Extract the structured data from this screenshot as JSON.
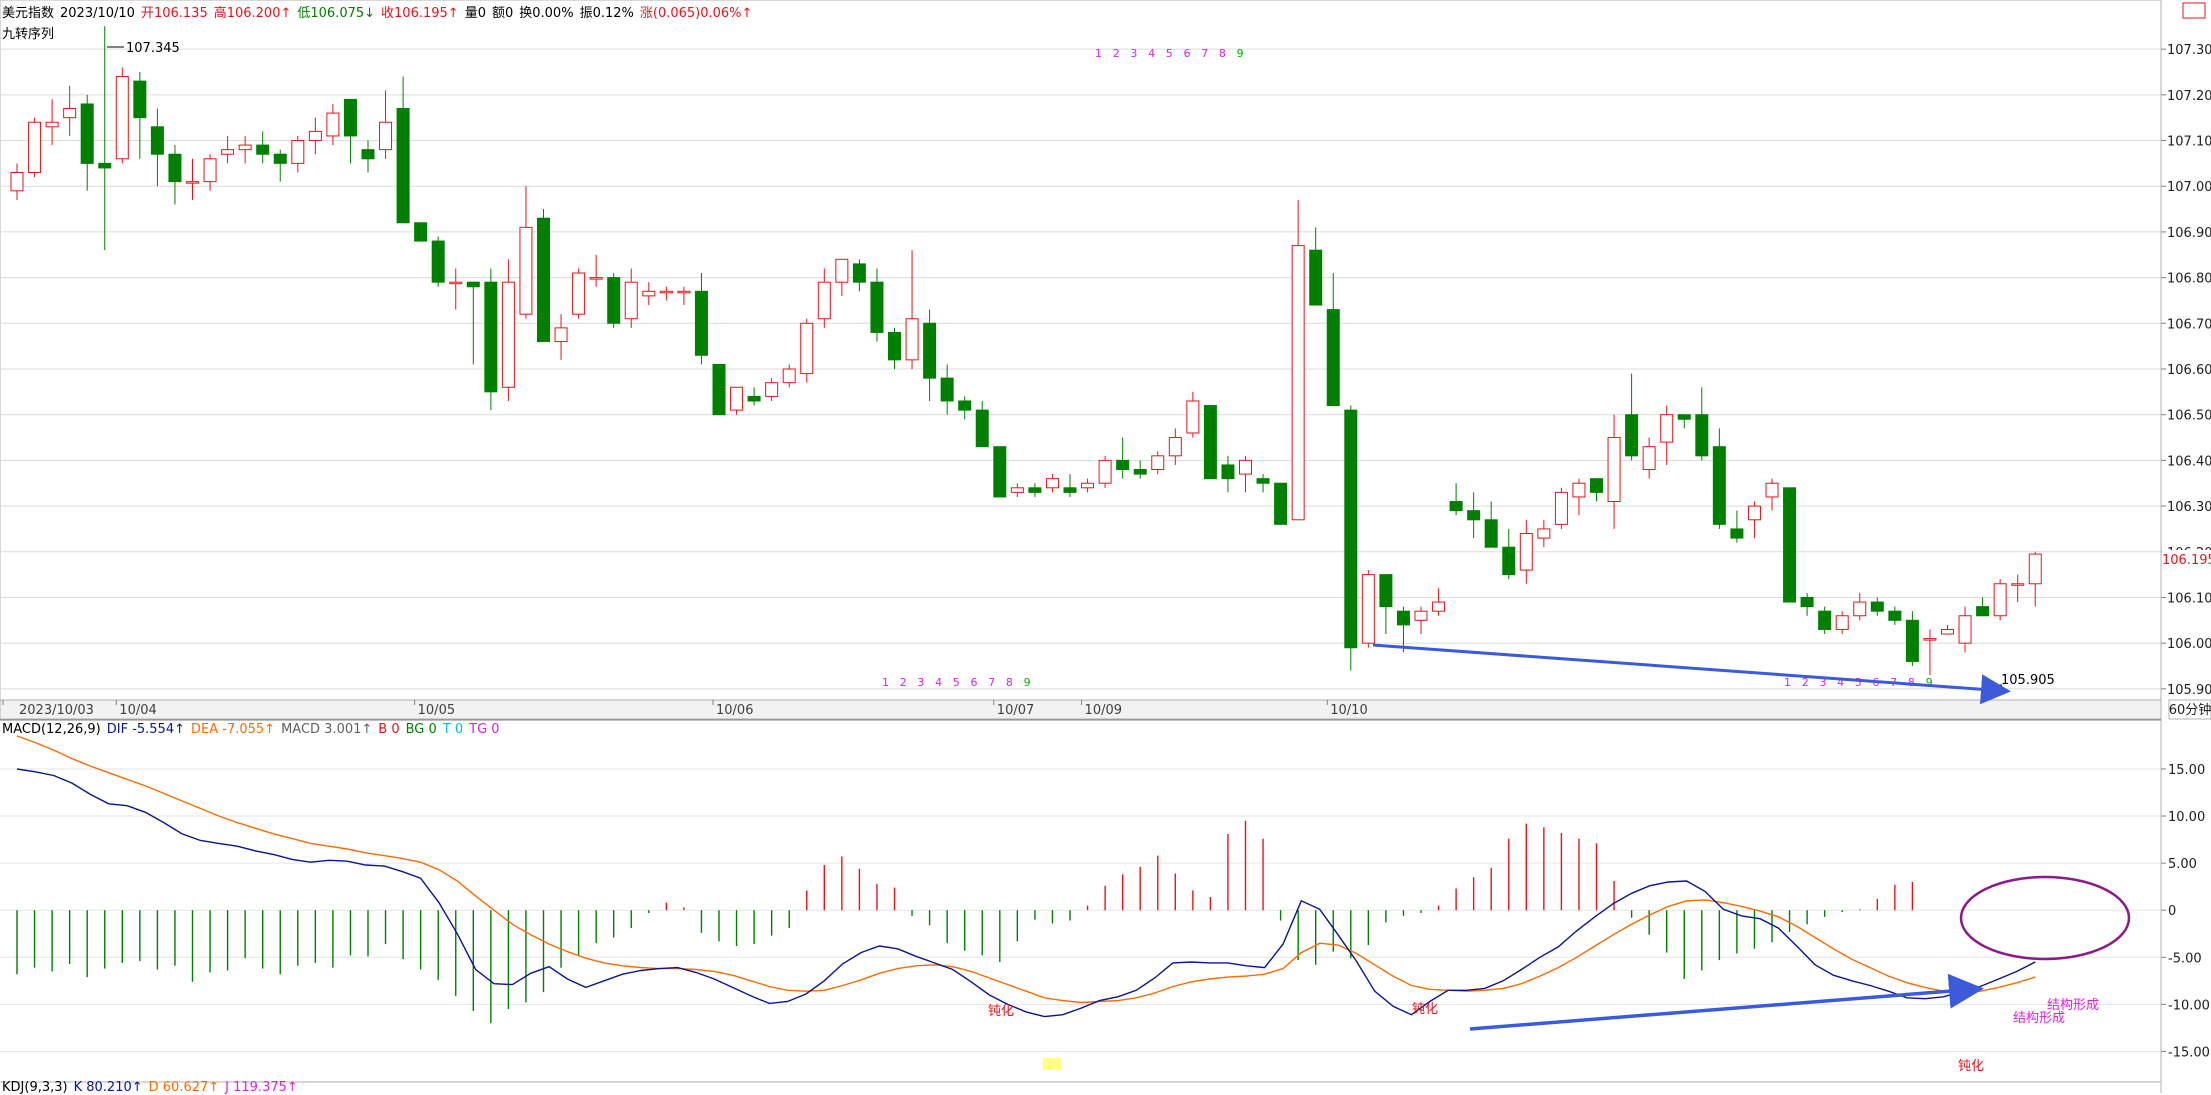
{
  "header": {
    "name": "美元指数",
    "date": "2023/10/10",
    "open": "开106.135",
    "high": "高106.200↑",
    "low": "低106.075↓",
    "close": "收106.195↑",
    "volume": "量0",
    "amount": "额0",
    "turnover": "换0.00%",
    "amplitude": "振0.12%",
    "change": "涨(0.065)0.06%↑",
    "indicator_title": "九转序列"
  },
  "period_label": "60分钟",
  "price_axis": [
    "107.300",
    "107.200",
    "107.100",
    "107.000",
    "106.900",
    "106.800",
    "106.700",
    "106.600",
    "106.500",
    "106.400",
    "106.300",
    "106.200",
    "106.100",
    "106.000",
    "105.900"
  ],
  "current_price": "106.195",
  "high_marker": "107.345",
  "low_marker": "105.905",
  "date_axis": [
    "2023/10/03",
    "10/04",
    "10/05",
    "10/06",
    "10/07",
    "10/09",
    "10/10"
  ],
  "seq_top": [
    "1",
    "2",
    "3",
    "4",
    "5",
    "6",
    "7",
    "8",
    "9"
  ],
  "seq_bottom1": [
    "1",
    "2",
    "3",
    "4",
    "5",
    "6",
    "7",
    "8",
    "9"
  ],
  "seq_bottom2": [
    "1",
    "2",
    "3",
    "4",
    "5",
    "6",
    "7",
    "8",
    "9"
  ],
  "macd": {
    "label": "MACD(12,26,9)",
    "dif": "DIF -5.554↑",
    "dea": "DEA -7.055↑",
    "macd": "MACD 3.001↑",
    "b": "B 0",
    "bg": "BG 0",
    "t": "T 0",
    "tg": "TG 0",
    "axis": [
      "15.00",
      "10.00",
      "5.00",
      "0",
      "-5.00",
      "-10.00",
      "-15.00"
    ],
    "annotations": [
      "钝化",
      "钝化",
      "钝化",
      "结构形成",
      "结构形成"
    ]
  },
  "kdj": {
    "label": "KDJ(9,3,3)",
    "k": "K 80.210↑",
    "d": "D 60.627↑",
    "j": "J 119.375↑"
  },
  "colors": {
    "up": "#e8141c",
    "down": "#008000",
    "dif": "#0a1496",
    "dea": "#ff6a00",
    "arrow": "#3b5bdb",
    "circle": "#8b1a8b"
  },
  "chart_data": {
    "type": "candlestick",
    "title": "美元指数 60分钟",
    "ylim": [
      105.88,
      107.39
    ],
    "candles": [
      [
        106.99,
        107.03,
        106.97,
        107.05
      ],
      [
        107.03,
        107.14,
        107.02,
        107.15
      ],
      [
        107.13,
        107.14,
        107.09,
        107.19
      ],
      [
        107.15,
        107.17,
        107.11,
        107.22
      ],
      [
        107.18,
        107.05,
        106.99,
        107.2
      ],
      [
        107.05,
        107.04,
        106.86,
        107.35
      ],
      [
        107.06,
        107.24,
        107.05,
        107.26
      ],
      [
        107.23,
        107.15,
        107.06,
        107.25
      ],
      [
        107.13,
        107.07,
        107.0,
        107.17
      ],
      [
        107.07,
        107.01,
        106.96,
        107.09
      ],
      [
        107.01,
        107.01,
        106.97,
        107.06
      ],
      [
        107.01,
        107.06,
        106.99,
        107.07
      ],
      [
        107.07,
        107.08,
        107.05,
        107.11
      ],
      [
        107.08,
        107.09,
        107.05,
        107.11
      ],
      [
        107.09,
        107.07,
        107.05,
        107.12
      ],
      [
        107.07,
        107.05,
        107.01,
        107.08
      ],
      [
        107.05,
        107.1,
        107.03,
        107.11
      ],
      [
        107.1,
        107.12,
        107.07,
        107.15
      ],
      [
        107.11,
        107.16,
        107.09,
        107.18
      ],
      [
        107.19,
        107.11,
        107.05,
        107.19
      ],
      [
        107.08,
        107.06,
        107.03,
        107.1
      ],
      [
        107.08,
        107.14,
        107.06,
        107.21
      ],
      [
        107.17,
        106.92,
        106.92,
        107.24
      ],
      [
        106.92,
        106.88,
        106.88,
        106.91
      ],
      [
        106.88,
        106.79,
        106.78,
        106.89
      ],
      [
        106.79,
        106.79,
        106.73,
        106.82
      ],
      [
        106.79,
        106.78,
        106.61,
        106.79
      ],
      [
        106.79,
        106.55,
        106.51,
        106.82
      ],
      [
        106.56,
        106.79,
        106.53,
        106.84
      ],
      [
        106.72,
        106.91,
        106.71,
        107.0
      ],
      [
        106.93,
        106.66,
        106.66,
        106.95
      ],
      [
        106.66,
        106.69,
        106.62,
        106.72
      ],
      [
        106.72,
        106.81,
        106.71,
        106.82
      ],
      [
        106.8,
        106.8,
        106.78,
        106.85
      ],
      [
        106.8,
        106.7,
        106.69,
        106.81
      ],
      [
        106.71,
        106.79,
        106.69,
        106.82
      ],
      [
        106.76,
        106.77,
        106.74,
        106.79
      ],
      [
        106.77,
        106.77,
        106.75,
        106.78
      ],
      [
        106.77,
        106.77,
        106.74,
        106.78
      ],
      [
        106.77,
        106.63,
        106.61,
        106.81
      ],
      [
        106.61,
        106.5,
        106.5,
        106.61
      ],
      [
        106.51,
        106.56,
        106.5,
        106.56
      ],
      [
        106.54,
        106.53,
        106.52,
        106.56
      ],
      [
        106.54,
        106.57,
        106.53,
        106.58
      ],
      [
        106.57,
        106.6,
        106.56,
        106.61
      ],
      [
        106.59,
        106.7,
        106.57,
        106.71
      ],
      [
        106.71,
        106.79,
        106.69,
        106.82
      ],
      [
        106.79,
        106.84,
        106.76,
        106.84
      ],
      [
        106.83,
        106.79,
        106.77,
        106.84
      ],
      [
        106.79,
        106.68,
        106.66,
        106.82
      ],
      [
        106.68,
        106.62,
        106.6,
        106.69
      ],
      [
        106.62,
        106.71,
        106.6,
        106.86
      ],
      [
        106.7,
        106.58,
        106.53,
        106.73
      ],
      [
        106.58,
        106.53,
        106.5,
        106.61
      ],
      [
        106.53,
        106.51,
        106.49,
        106.54
      ],
      [
        106.51,
        106.43,
        106.43,
        106.53
      ],
      [
        106.43,
        106.32,
        106.32,
        106.43
      ],
      [
        106.33,
        106.34,
        106.32,
        106.35
      ],
      [
        106.34,
        106.33,
        106.32,
        106.35
      ],
      [
        106.34,
        106.36,
        106.33,
        106.37
      ],
      [
        106.34,
        106.33,
        106.32,
        106.37
      ],
      [
        106.34,
        106.35,
        106.33,
        106.36
      ],
      [
        106.35,
        106.4,
        106.34,
        106.41
      ],
      [
        106.4,
        106.38,
        106.36,
        106.45
      ],
      [
        106.38,
        106.37,
        106.36,
        106.4
      ],
      [
        106.38,
        106.41,
        106.37,
        106.42
      ],
      [
        106.41,
        106.45,
        106.39,
        106.47
      ],
      [
        106.46,
        106.53,
        106.45,
        106.55
      ],
      [
        106.52,
        106.36,
        106.36,
        106.52
      ],
      [
        106.39,
        106.36,
        106.33,
        106.41
      ],
      [
        106.37,
        106.4,
        106.33,
        106.41
      ],
      [
        106.36,
        106.35,
        106.33,
        106.37
      ],
      [
        106.35,
        106.26,
        106.26,
        106.35
      ],
      [
        106.27,
        106.87,
        106.27,
        106.97
      ],
      [
        106.86,
        106.74,
        106.74,
        106.91
      ],
      [
        106.73,
        106.52,
        106.57,
        106.81
      ],
      [
        106.51,
        105.99,
        105.94,
        106.52
      ],
      [
        106.0,
        106.15,
        105.99,
        106.16
      ],
      [
        106.15,
        106.08,
        106.02,
        106.15
      ],
      [
        106.07,
        106.04,
        105.98,
        106.08
      ],
      [
        106.05,
        106.07,
        106.02,
        106.08
      ],
      [
        106.07,
        106.09,
        106.06,
        106.12
      ],
      [
        106.31,
        106.29,
        106.28,
        106.35
      ],
      [
        106.29,
        106.27,
        106.23,
        106.33
      ],
      [
        106.27,
        106.21,
        106.21,
        106.31
      ],
      [
        106.21,
        106.15,
        106.14,
        106.25
      ],
      [
        106.16,
        106.24,
        106.13,
        106.27
      ],
      [
        106.23,
        106.25,
        106.21,
        106.27
      ],
      [
        106.26,
        106.33,
        106.25,
        106.34
      ],
      [
        106.32,
        106.35,
        106.28,
        106.36
      ],
      [
        106.36,
        106.33,
        106.31,
        106.36
      ],
      [
        106.31,
        106.45,
        106.25,
        106.5
      ],
      [
        106.5,
        106.41,
        106.4,
        106.59
      ],
      [
        106.38,
        106.43,
        106.36,
        106.45
      ],
      [
        106.44,
        106.5,
        106.39,
        106.52
      ],
      [
        106.5,
        106.49,
        106.47,
        106.5
      ],
      [
        106.5,
        106.41,
        106.4,
        106.56
      ],
      [
        106.43,
        106.26,
        106.25,
        106.47
      ],
      [
        106.25,
        106.23,
        106.22,
        106.29
      ],
      [
        106.27,
        106.3,
        106.23,
        106.31
      ],
      [
        106.32,
        106.35,
        106.29,
        106.36
      ],
      [
        106.34,
        106.09,
        106.09,
        106.34
      ],
      [
        106.1,
        106.08,
        106.06,
        106.11
      ],
      [
        106.07,
        106.03,
        106.02,
        106.08
      ],
      [
        106.03,
        106.06,
        106.02,
        106.07
      ],
      [
        106.06,
        106.09,
        106.05,
        106.11
      ],
      [
        106.09,
        106.07,
        106.06,
        106.1
      ],
      [
        106.07,
        106.05,
        106.04,
        106.08
      ],
      [
        106.05,
        105.96,
        105.95,
        106.07
      ],
      [
        106.01,
        106.01,
        105.93,
        106.03
      ],
      [
        106.02,
        106.03,
        106.02,
        106.04
      ],
      [
        106.0,
        106.06,
        105.98,
        106.08
      ],
      [
        106.08,
        106.06,
        106.06,
        106.1
      ],
      [
        106.06,
        106.13,
        106.05,
        106.14
      ],
      [
        106.13,
        106.13,
        106.09,
        106.15
      ],
      [
        106.13,
        106.195,
        106.08,
        106.2
      ]
    ],
    "histogram": [
      -6.8,
      -6.1,
      -6.5,
      -5.7,
      -7.1,
      -6.2,
      -5.6,
      -5.4,
      -6.3,
      -5.9,
      -7.6,
      -6.6,
      -6.4,
      -5.1,
      -6.2,
      -6.8,
      -5.9,
      -5.6,
      -6.1,
      -4.8,
      -4.9,
      -3.6,
      -5.2,
      -6.3,
      -7.4,
      -9.1,
      -10.7,
      -12.0,
      -10.5,
      -9.8,
      -8.7,
      -6.1,
      -4.8,
      -3.5,
      -2.9,
      -1.9,
      -0.3,
      0.8,
      0.3,
      -2.4,
      -3.3,
      -3.8,
      -3.6,
      -2.7,
      -1.9,
      2.1,
      4.8,
      5.7,
      4.4,
      2.8,
      2.4,
      -0.6,
      -1.6,
      -3.5,
      -4.3,
      -4.8,
      -5.5,
      -3.3,
      -1.0,
      -1.4,
      -1.1,
      0.5,
      2.6,
      3.8,
      4.6,
      5.8,
      3.9,
      2.1,
      1.4,
      8.1,
      9.5,
      7.6,
      -1.1,
      -5.3,
      -5.8,
      -4.4,
      -5.1,
      -3.7,
      -1.3,
      -0.6,
      -0.3,
      0.5,
      2.3,
      3.5,
      4.5,
      7.6,
      9.2,
      8.8,
      8.2,
      7.6,
      7.1,
      3.1,
      -0.8,
      -2.6,
      -4.5,
      -7.3,
      -6.4,
      -5.3,
      -4.6,
      -4.1,
      -3.4,
      -2.3,
      -1.5,
      -0.7,
      -0.2,
      0.1,
      1.2,
      2.7,
      3.0
    ],
    "dif_points": [
      15.0,
      14.7,
      14.3,
      13.5,
      12.3,
      11.3,
      11.1,
      10.4,
      9.3,
      8.1,
      7.4,
      7.1,
      6.8,
      6.3,
      5.9,
      5.4,
      5.1,
      5.3,
      5.2,
      4.8,
      4.7,
      4.1,
      3.4,
      0.8,
      -2.5,
      -6.3,
      -7.8,
      -7.9,
      -6.7,
      -6.0,
      -7.3,
      -8.2,
      -7.5,
      -6.8,
      -6.4,
      -6.2,
      -6.1,
      -6.6,
      -7.3,
      -8.2,
      -9.1,
      -9.9,
      -9.7,
      -8.9,
      -7.5,
      -5.7,
      -4.5,
      -3.8,
      -4.1,
      -4.9,
      -5.6,
      -6.3,
      -7.6,
      -9.0,
      -10.0,
      -10.8,
      -11.3,
      -11.1,
      -10.4,
      -9.6,
      -9.2,
      -8.5,
      -7.2,
      -5.6,
      -5.5,
      -5.6,
      -5.6,
      -5.9,
      -6.1,
      -3.6,
      1.0,
      0.1,
      -2.6,
      -5.4,
      -8.6,
      -10.2,
      -11.1,
      -9.7,
      -8.5,
      -8.5,
      -8.3,
      -7.5,
      -6.3,
      -5.0,
      -3.9,
      -2.2,
      -0.7,
      0.7,
      1.8,
      2.6,
      3.0,
      3.1,
      2.0,
      0.1,
      -0.6,
      -0.9,
      -1.9,
      -3.8,
      -5.8,
      -6.9,
      -7.5,
      -8.0,
      -8.6,
      -9.3,
      -9.4,
      -9.2,
      -8.6,
      -8.1,
      -7.3,
      -6.5,
      -5.5
    ],
    "dea_points": [
      18.5,
      17.8,
      17.0,
      16.1,
      15.3,
      14.6,
      13.9,
      13.2,
      12.4,
      11.6,
      10.8,
      10.0,
      9.3,
      8.7,
      8.1,
      7.6,
      7.1,
      6.8,
      6.5,
      6.1,
      5.8,
      5.5,
      5.1,
      4.3,
      3.1,
      1.5,
      0.0,
      -1.5,
      -2.6,
      -3.6,
      -4.4,
      -5.1,
      -5.6,
      -5.9,
      -6.1,
      -6.2,
      -6.2,
      -6.3,
      -6.5,
      -6.9,
      -7.5,
      -8.1,
      -8.5,
      -8.6,
      -8.5,
      -8.0,
      -7.4,
      -6.7,
      -6.2,
      -5.9,
      -5.8,
      -6.0,
      -6.5,
      -7.2,
      -7.9,
      -8.6,
      -9.3,
      -9.6,
      -9.8,
      -9.7,
      -9.6,
      -9.3,
      -8.8,
      -8.1,
      -7.6,
      -7.3,
      -7.1,
      -7.0,
      -6.8,
      -6.2,
      -4.5,
      -3.5,
      -3.7,
      -4.6,
      -5.8,
      -7.0,
      -8.0,
      -8.4,
      -8.5,
      -8.6,
      -8.5,
      -8.3,
      -7.8,
      -7.0,
      -6.1,
      -5.0,
      -3.8,
      -2.6,
      -1.5,
      -0.5,
      0.4,
      1.0,
      1.1,
      0.8,
      0.4,
      -0.1,
      -0.7,
      -1.7,
      -2.9,
      -4.1,
      -5.2,
      -6.1,
      -7.0,
      -7.7,
      -8.2,
      -8.6,
      -8.7,
      -8.6,
      -8.2,
      -7.7,
      -7.1
    ]
  }
}
